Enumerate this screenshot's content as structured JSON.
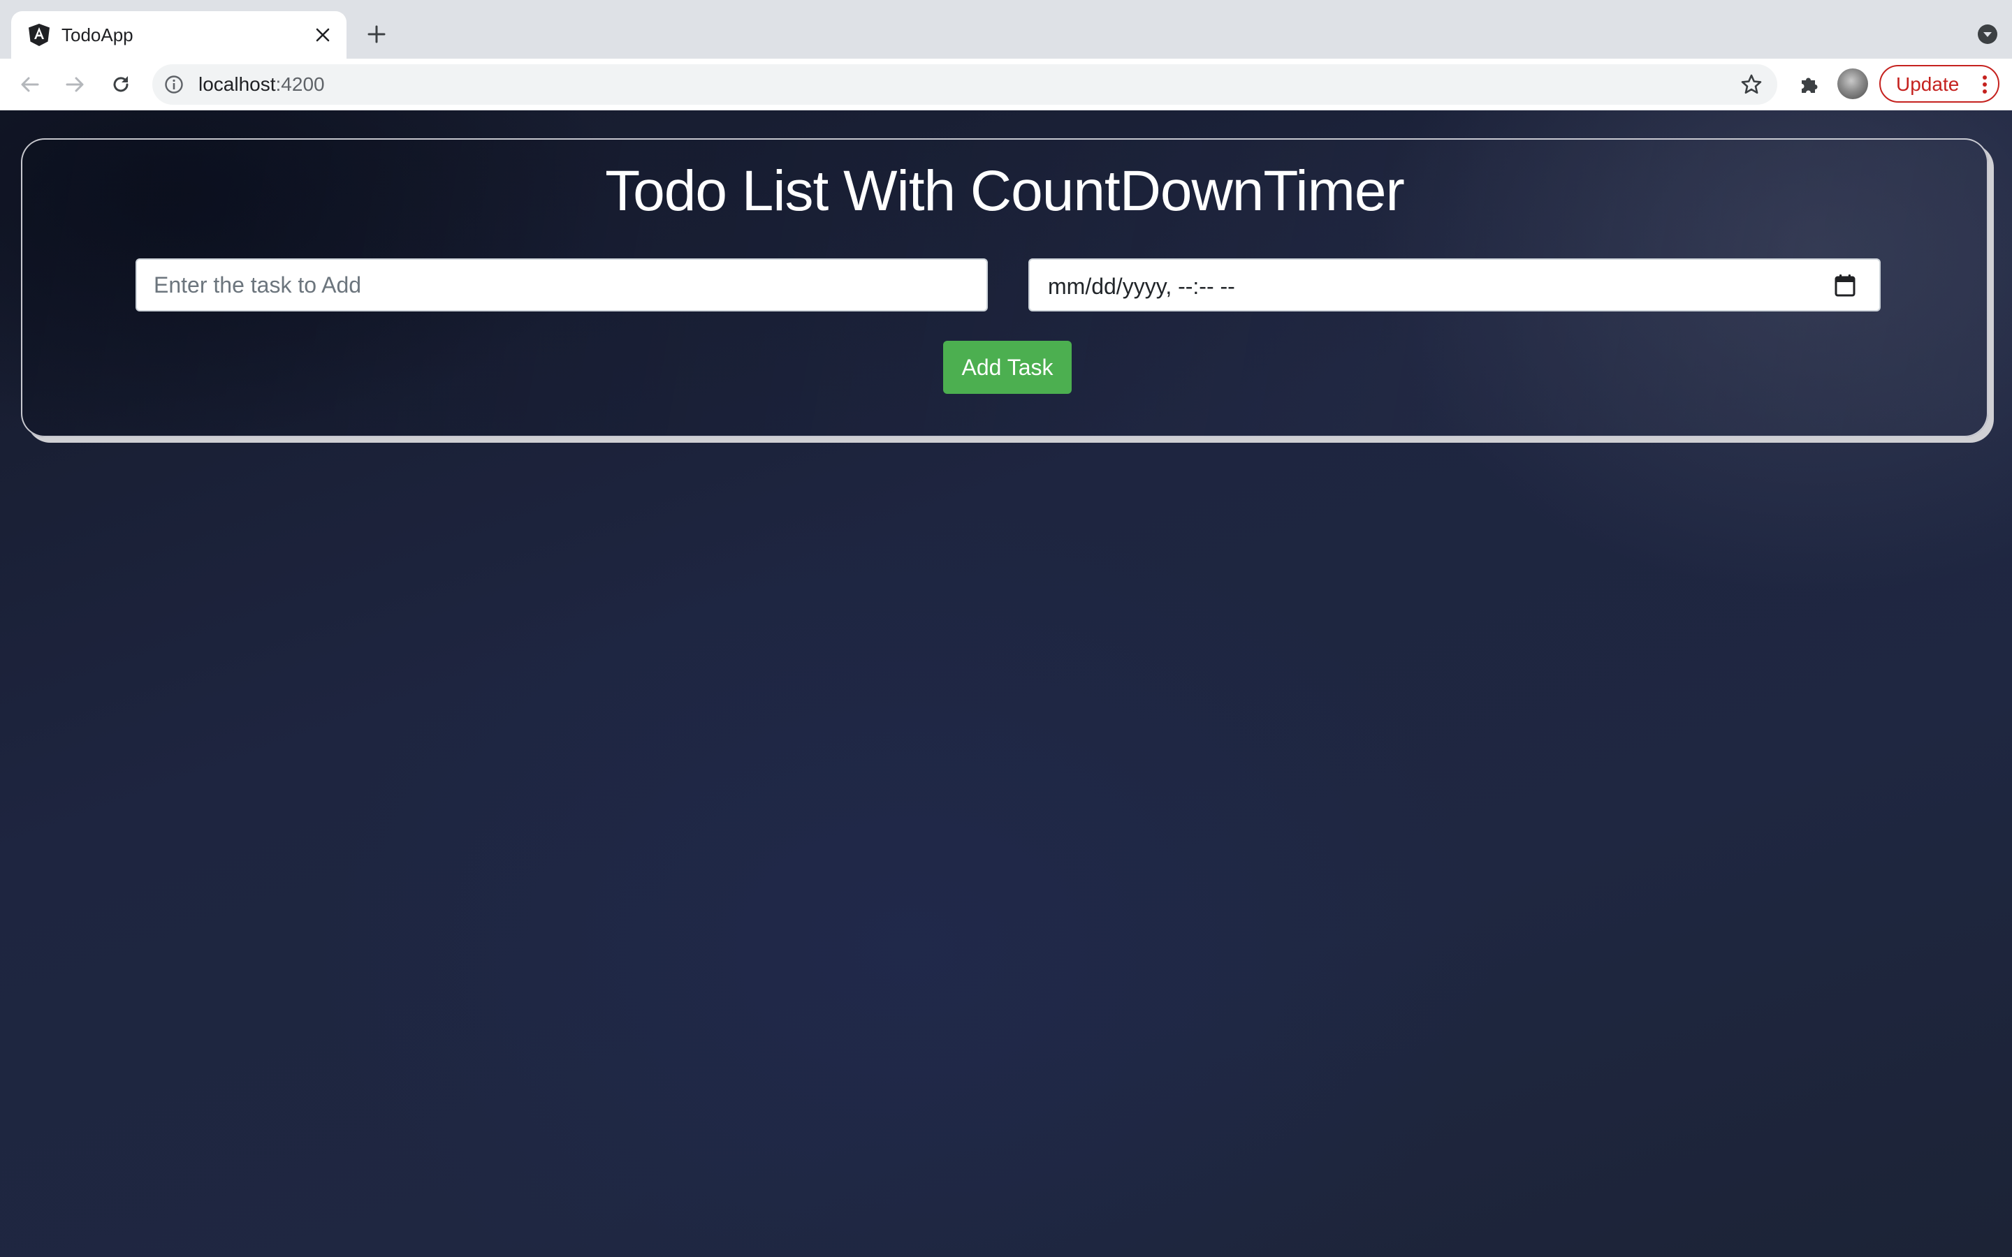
{
  "browser": {
    "tab": {
      "title": "TodoApp",
      "favicon": "angular-logo-icon"
    },
    "omnibox": {
      "host": "localhost",
      "port": ":4200"
    },
    "update_label": "Update",
    "icons": {
      "back": "back-arrow-icon",
      "forward": "forward-arrow-icon",
      "reload": "reload-icon",
      "info": "info-icon",
      "star": "star-icon",
      "extensions": "puzzle-icon",
      "new_tab": "plus-icon",
      "tab_close": "close-icon",
      "tab_search": "chevron-down-icon",
      "menu": "kebab-menu-icon"
    }
  },
  "app": {
    "title": "Todo List With CountDownTimer",
    "task_input": {
      "placeholder": "Enter the task to Add",
      "value": ""
    },
    "date_input": {
      "display": "mm/dd/yyyy, --:-- --"
    },
    "add_button_label": "Add Task"
  },
  "colors": {
    "accent_green": "#4caf50",
    "update_red": "#c5221f",
    "page_background": "#1e2540"
  }
}
